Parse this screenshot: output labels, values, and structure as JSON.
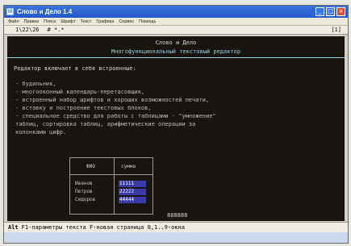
{
  "window": {
    "title": "Слово и Дело 1.4",
    "icon_label": "W"
  },
  "controls": {
    "minimize": "_",
    "maximize": "□",
    "close": "×"
  },
  "menu": [
    "Файл",
    "Правка",
    "Поиск",
    "Шрифт",
    "Текст",
    "Графика",
    "Сервис",
    "Помощь"
  ],
  "status": {
    "position": "1\\22\\26",
    "marks": "# *.*",
    "right_indicator": "[1]"
  },
  "document": {
    "title": "Слово и Дело",
    "subtitle": "Многофункциональный текстовый редактор",
    "intro": "Редактор включает в себя встроенные:",
    "bullets": [
      "- будильник,",
      "- многооконный календарь-перетасовщик,",
      "- встроенный набор шрифтов и хороших возможностей печати,",
      "- вставку и построение текстовых блоков,",
      "- специальное средство для работы с таблицами - \"умножение\"",
      "  таблиц, сортировка таблиц, арифметические операции за",
      "  колонками цифр."
    ]
  },
  "table": {
    "headers": [
      "ФИО",
      "сумма"
    ],
    "rows": [
      {
        "name": "Иванов",
        "value": "11111"
      },
      {
        "name": "Петров",
        "value": "22222"
      },
      {
        "name": "Сидоров",
        "value": "44444"
      }
    ]
  },
  "page_number": "888888",
  "bottom": {
    "key_label": "Alt",
    "text": "F1-параметры текста F-новая страница 0,1..9-окна"
  },
  "colors": {
    "screen_bg": "#181410",
    "accent_cyan": "#9ecdde",
    "selection": "#3a3aa8",
    "titlebar": "#2458c8"
  }
}
